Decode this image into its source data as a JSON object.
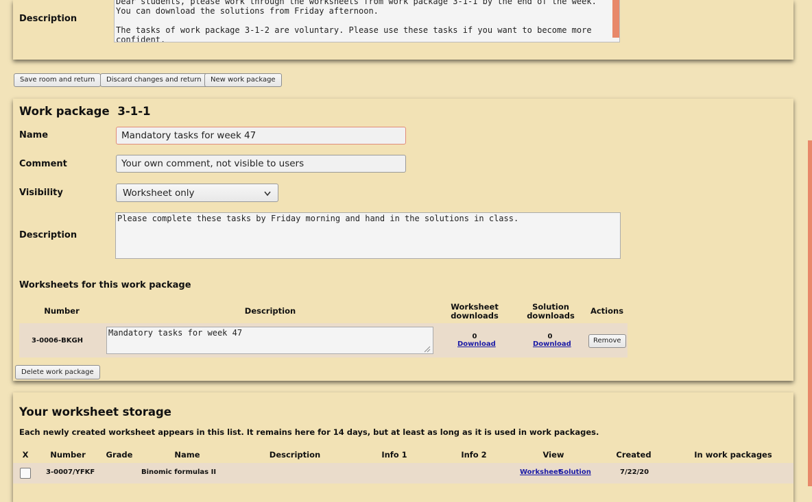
{
  "top_panel": {
    "description_label": "Description",
    "description_text": "Dear students, please work through the worksheets from work package 3-1-1 by the end of the week.\nYou can download the solutions from Friday afternoon.\n\nThe tasks of work package 3-1-2 are voluntary. Please use these tasks if you want to become more confident."
  },
  "room_actions": {
    "save": "Save room and return",
    "discard": "Discard changes and return",
    "new_wp": "New work package"
  },
  "work_package": {
    "title_prefix": "Work package",
    "number": "3-1-1",
    "name_label": "Name",
    "name_value": "Mandatory tasks for week 47",
    "comment_label": "Comment",
    "comment_placeholder": "Your own comment, not visible to users",
    "visibility_label": "Visibility",
    "visibility_value": "Worksheet only",
    "description_label": "Description",
    "description_value": "Please complete these tasks by Friday morning and hand in the solutions in class.",
    "worksheets_heading": "Worksheets for this work package",
    "columns": {
      "number": "Number",
      "description": "Description",
      "worksheet_downloads_1": "Worksheet",
      "worksheet_downloads_2": "downloads",
      "solution_downloads_1": "Solution",
      "solution_downloads_2": "downloads",
      "actions": "Actions"
    },
    "rows": [
      {
        "number": "3-0006-BKGH",
        "description": "Mandatory tasks for week 47",
        "worksheet_downloads": "0",
        "worksheet_link": "Download",
        "solution_downloads": "0",
        "solution_link": "Download",
        "action": "Remove"
      }
    ],
    "delete_button": "Delete work package"
  },
  "storage": {
    "heading": "Your worksheet storage",
    "info": "Each newly created worksheet appears in this list. It remains here for 14 days, but at least as long as it is used in work packages.",
    "columns": [
      "X",
      "Number",
      "Grade",
      "Name",
      "Description",
      "Info 1",
      "Info 2",
      "View",
      "Created",
      "In work packages"
    ],
    "rows": [
      {
        "number": "3-0007/YFKF",
        "grade": "",
        "name": "Binomic formulas II",
        "description": "",
        "info1": "",
        "info2": "",
        "view_worksheet": "Worksheet",
        "view_solution": "Solution",
        "created": "7/22/20",
        "in_work_packages": ""
      }
    ]
  },
  "colors": {
    "page_bg": "#f2e3b9",
    "panel_bg": "#f2e2b5",
    "row_bg": "#eadccb",
    "scroll_accent": "#e8886a",
    "input_focus_border": "#e08a78",
    "link": "#1a1aa6"
  }
}
